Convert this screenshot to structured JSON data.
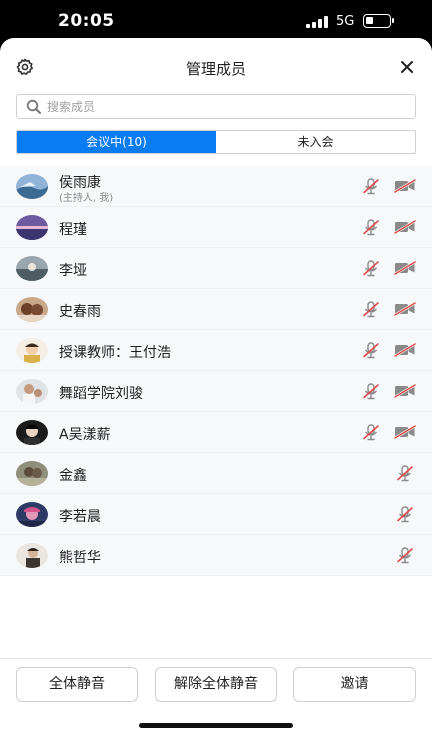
{
  "status_bar": {
    "time": "20:05",
    "network": "5G"
  },
  "header": {
    "title": "管理成员"
  },
  "search": {
    "placeholder": "搜索成员"
  },
  "tabs": [
    {
      "label": "会议中(10)",
      "active": true
    },
    {
      "label": "未入会",
      "active": false
    }
  ],
  "members": [
    {
      "name": "侯雨康",
      "subtitle": "(主持人, 我)",
      "mic": "muted",
      "camera": "off"
    },
    {
      "name": "程瑾",
      "mic": "muted",
      "camera": "off"
    },
    {
      "name": "李垭",
      "mic": "muted",
      "camera": "off"
    },
    {
      "name": "史春雨",
      "mic": "muted",
      "camera": "off"
    },
    {
      "name": "授课教师：王付浩",
      "mic": "muted",
      "camera": "off"
    },
    {
      "name": "舞蹈学院刘骏",
      "mic": "muted",
      "camera": "off"
    },
    {
      "name": "A吴漾薪",
      "mic": "muted",
      "camera": "off"
    },
    {
      "name": "金鑫",
      "mic": "muted"
    },
    {
      "name": "李若晨",
      "mic": "muted"
    },
    {
      "name": "熊哲华",
      "mic": "muted"
    }
  ],
  "footer": {
    "mute_all": "全体静音",
    "unmute_all": "解除全体静音",
    "invite": "邀请"
  },
  "colors": {
    "accent": "#0a7cf2",
    "muted_slash": "#e04b4b",
    "icon_gray": "#8a8a8a"
  }
}
